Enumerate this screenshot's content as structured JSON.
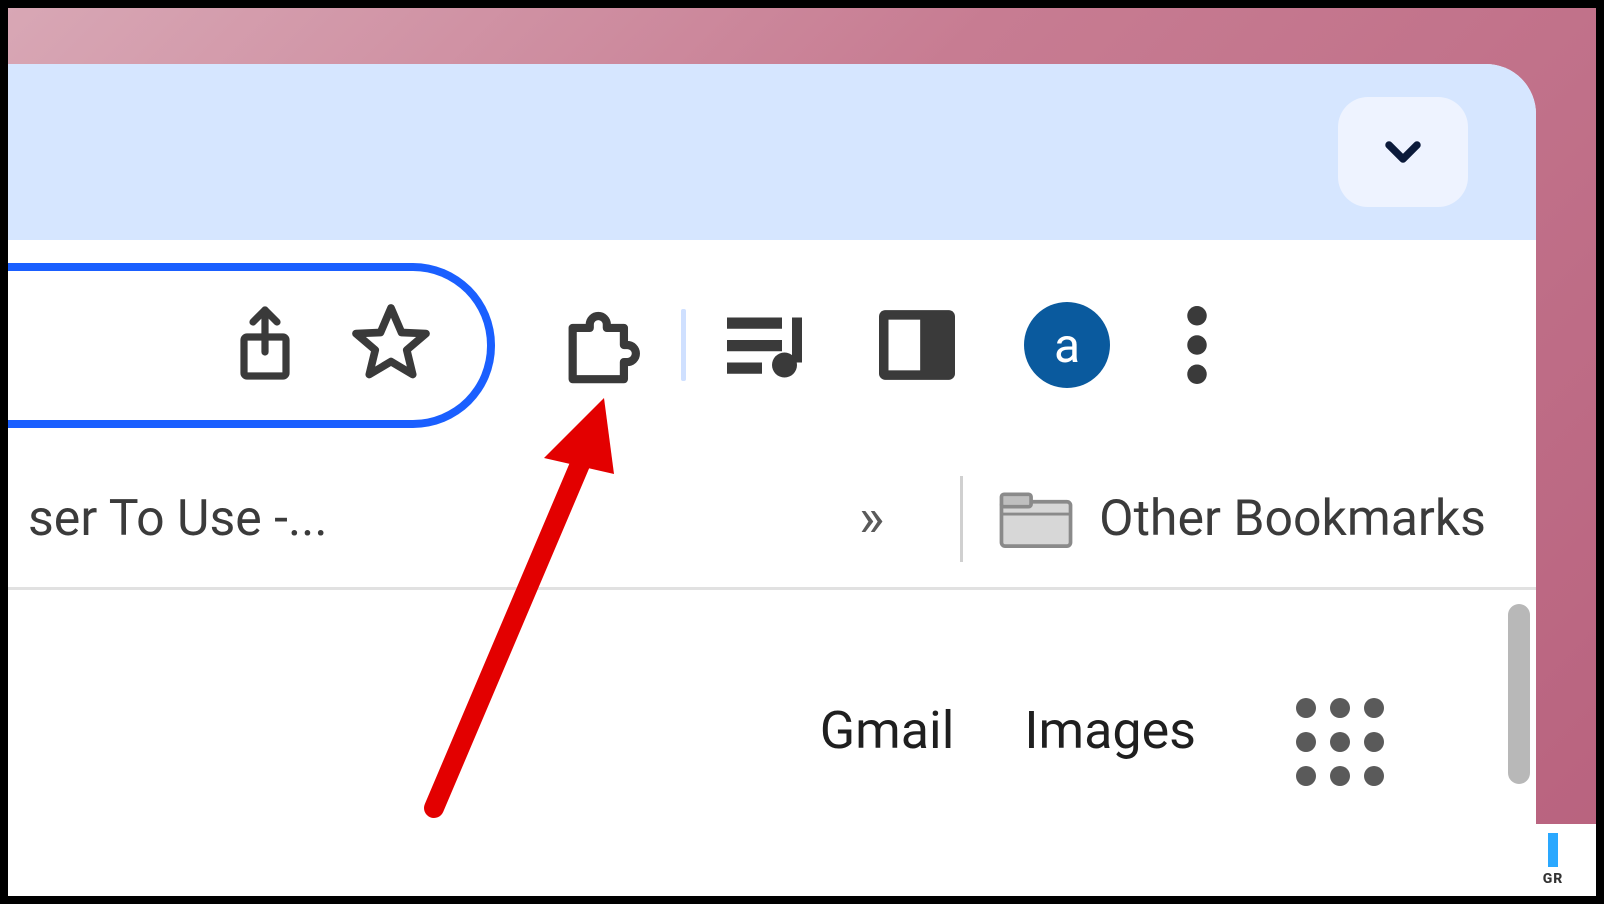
{
  "tab_strip": {
    "dropdown_icon": "chevron-down"
  },
  "address_bar": {
    "share_icon": "share",
    "bookmark_icon": "star-outline"
  },
  "toolbar": {
    "extensions_icon": "puzzle-piece",
    "media_icon": "music-queue",
    "sidepanel_icon": "side-panel",
    "profile_letter": "a",
    "menu_icon": "kebab-menu"
  },
  "bookmarks": {
    "truncated_item": "ser To Use -...",
    "overflow_label": "»",
    "other_label": "Other Bookmarks",
    "folder_icon": "folder"
  },
  "content": {
    "link_gmail": "Gmail",
    "link_images": "Images",
    "apps_icon": "apps-grid"
  },
  "watermark": {
    "text": "GR"
  },
  "annotation": {
    "type": "red-arrow",
    "target": "extensions-button"
  }
}
